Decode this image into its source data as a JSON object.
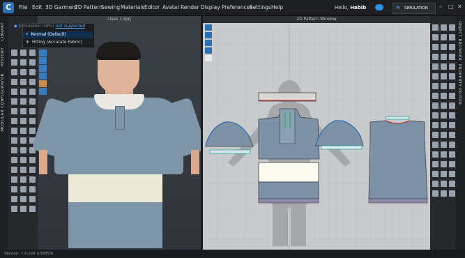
{
  "menubar": {
    "logo": "C",
    "items": [
      "File",
      "Edit",
      "3D Garment",
      "2D Pattern",
      "Sewing",
      "Materials",
      "Editor",
      "Avatar",
      "Render",
      "Display",
      "Preferences",
      "Settings",
      "Help"
    ],
    "greeting_prefix": "Hello,",
    "user_name": "Habib",
    "simulation_label": "SIMULATION"
  },
  "left_tabs": [
    "LIBRARY",
    "HISTORY",
    "MODULAR CONFIGURATOR"
  ],
  "right_tabs": [
    "OBJECT BROWSER",
    "PROPERTY EDITOR"
  ],
  "window_3d": {
    "title": "class 7.zprj",
    "simulation_menu": {
      "label": "Simulation (GPU)",
      "gpu_status": "not supported",
      "options": [
        "Normal (Default)",
        "Fitting (Accurate Fabric)"
      ],
      "selected": "Normal (Default)"
    }
  },
  "window_2d": {
    "title": "2D Pattern Window"
  },
  "colors": {
    "shirt": "#7e95a8",
    "stripe": "#ece9d6",
    "accent": "#2f6fb3",
    "pattern_bg": "#c9cacc"
  },
  "icons": [
    "menu-logo-icon",
    "cloud-icon",
    "simulation-icon",
    "minimize-icon",
    "maximize-icon",
    "close-icon"
  ],
  "status": {
    "version": "Version: 7.0.228 (r39853)"
  }
}
